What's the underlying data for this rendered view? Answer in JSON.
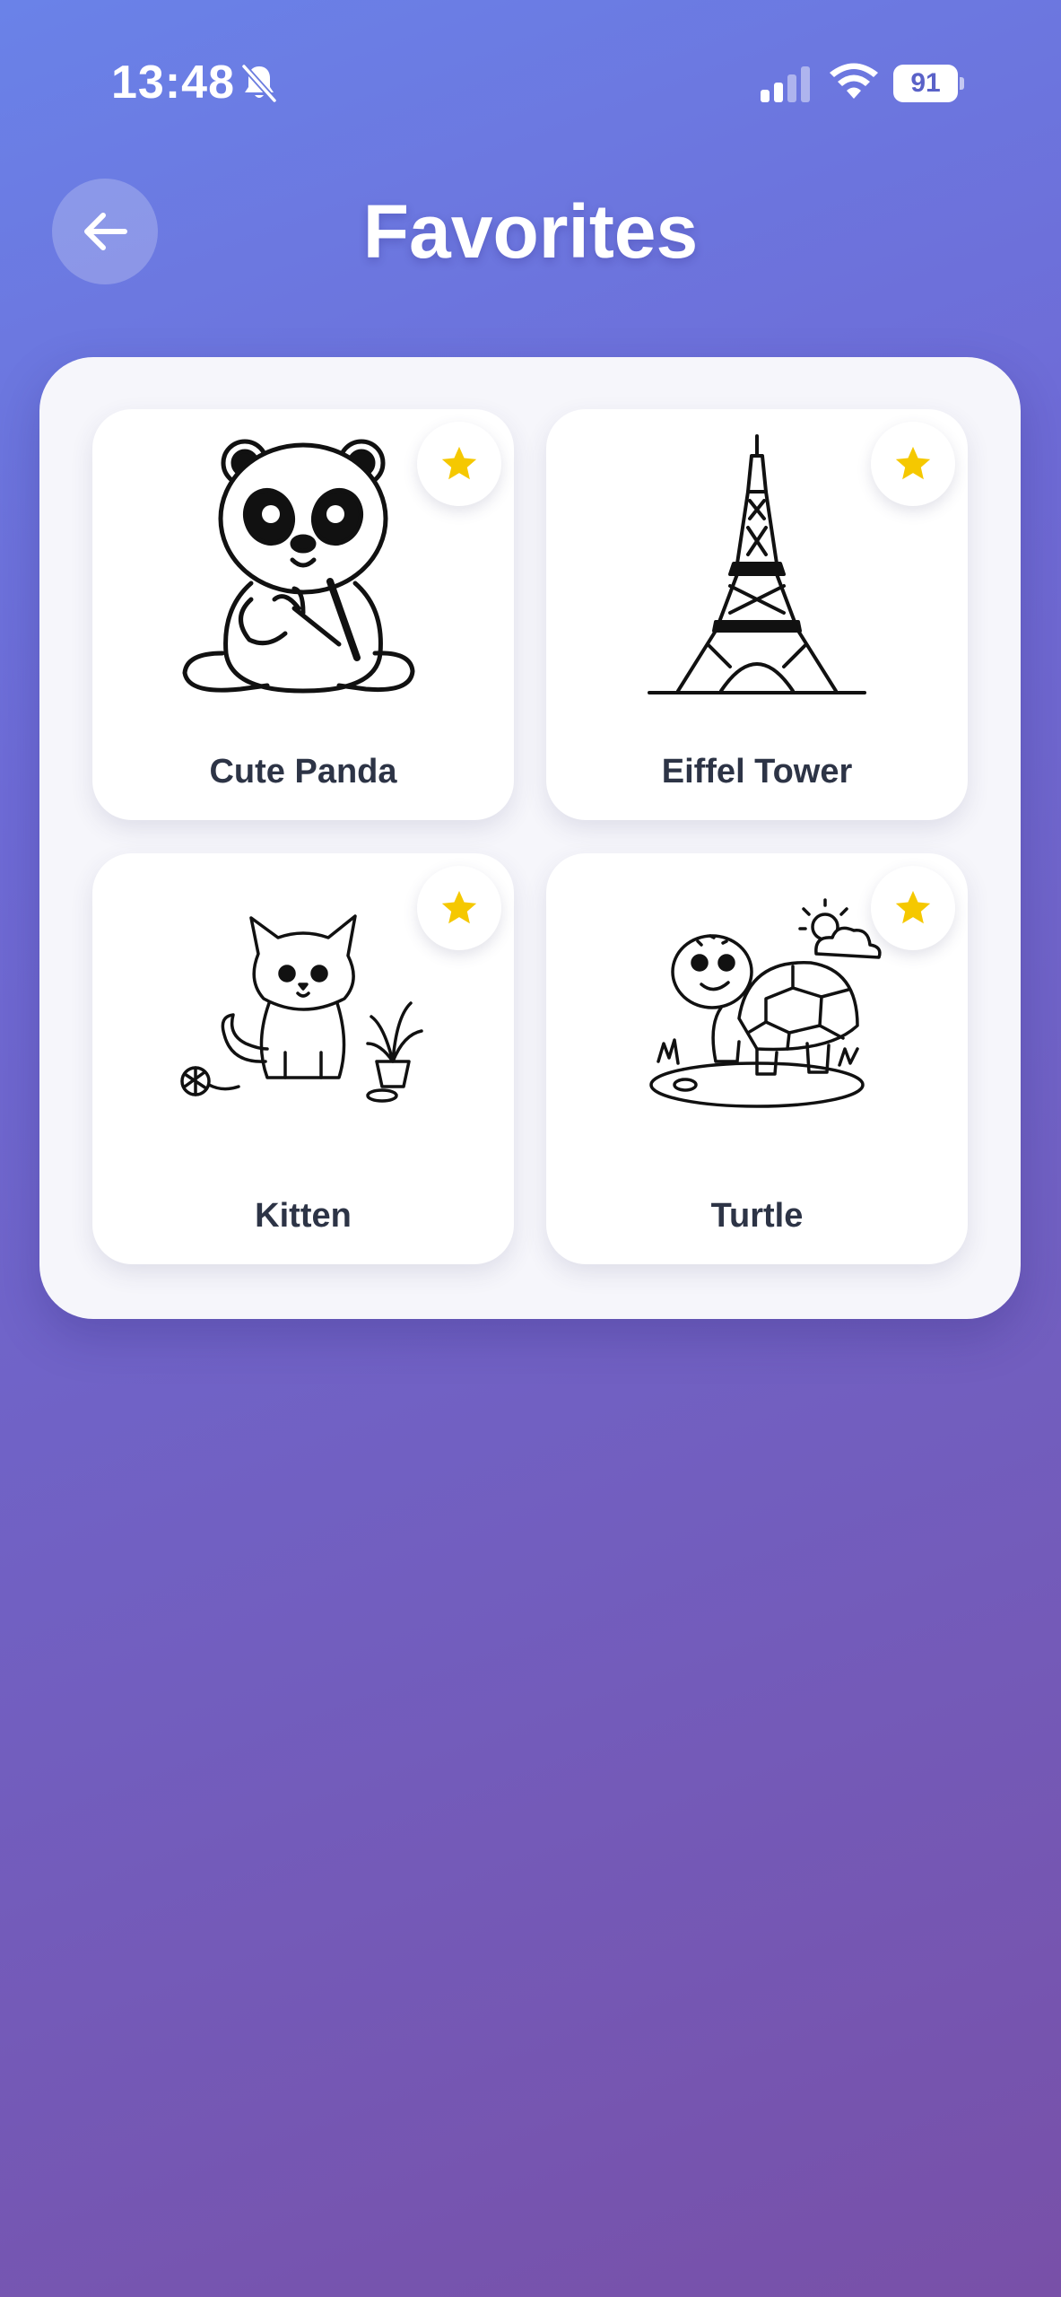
{
  "status_bar": {
    "time": "13:48",
    "battery": "91",
    "icons": [
      "bell-slash-icon",
      "cellular-signal-icon",
      "wifi-icon",
      "battery-icon"
    ]
  },
  "header": {
    "title": "Favorites",
    "back_icon": "arrow-left-icon"
  },
  "favorites": [
    {
      "title": "Cute Panda",
      "icon": "panda-drawing",
      "favorited": true
    },
    {
      "title": "Eiffel Tower",
      "icon": "eiffel-tower-drawing",
      "favorited": true
    },
    {
      "title": "Kitten",
      "icon": "kitten-drawing",
      "favorited": true
    },
    {
      "title": "Turtle",
      "icon": "turtle-drawing",
      "favorited": true
    }
  ],
  "colors": {
    "background_start": "#6a82e8",
    "background_end": "#7850a8",
    "panel": "#f6f6fb",
    "star": "#f5c800",
    "label_text": "#2d3446"
  }
}
